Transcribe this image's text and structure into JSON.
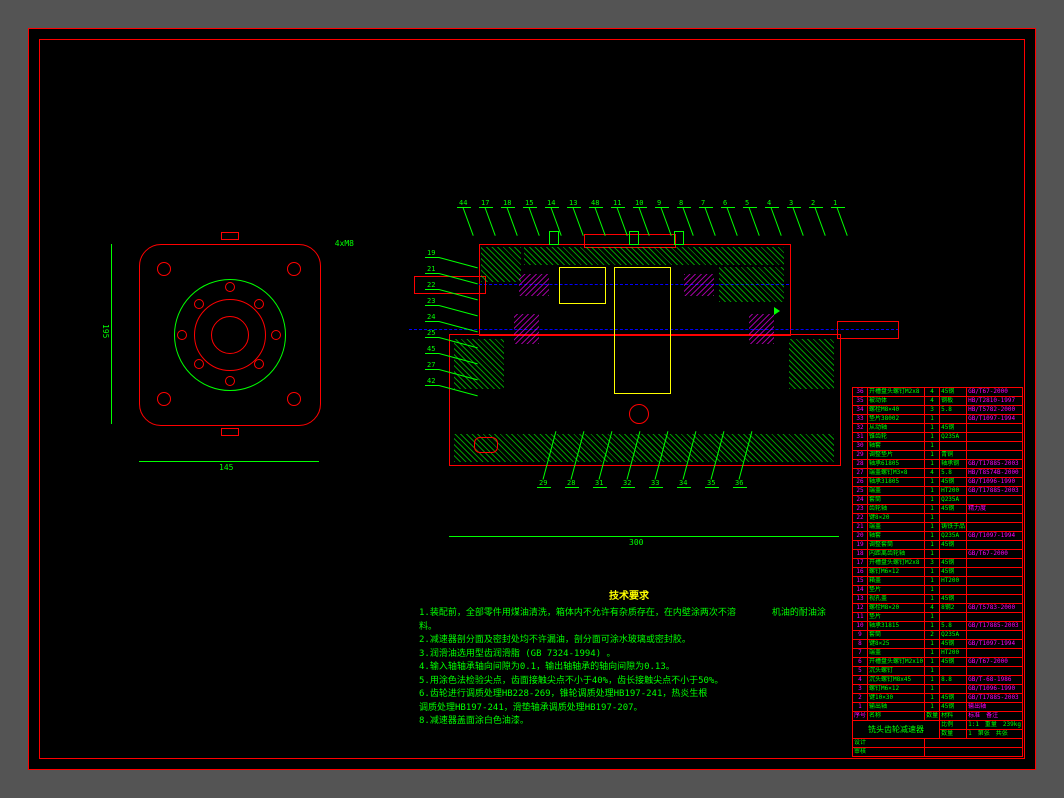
{
  "dimensions": {
    "flange_width": "145",
    "flange_height": "195",
    "section_length": "300",
    "hole_callout": "4xM8"
  },
  "tech_requirements": {
    "title": "技术要求",
    "items": [
      "1.装配前，全部零件用煤油清洗，箱体内不允许有杂质存在，在内壁涂两次不溶　　　　机油的耐油涂料。",
      "2.减速器剖分面及密封处均不许漏油，剖分面可涂水玻璃或密封胶。",
      "3.润滑油选用型齿润滑脂 (GB 7324-1994) 。",
      "4.输入轴轴承轴向间隙为0.1，输出轴轴承的轴向间隙为0.13。",
      "5.用涂色法检验尖点，齿面接触尖点不小于40%，齿长接触尖点不小于50%。",
      "6.齿轮进行调质处理HB228-269，锥轮调质处理HB197-241，热炎生根",
      "调质处理HB197-241，滑垫轴承调质处理HB197-207。",
      "8.减速器盖面涂白色油漆。"
    ]
  },
  "bom": [
    {
      "n": "36",
      "name": "开槽盘头螺钉M2x8",
      "q": "4",
      "mat": "45钢",
      "std": "GB/T67-2000"
    },
    {
      "n": "35",
      "name": "被动体",
      "q": "4",
      "mat": "钢板",
      "std": "HB/T2810-1997"
    },
    {
      "n": "34",
      "name": "螺栓M8×40",
      "q": "3",
      "mat": "5.8",
      "std": "HB/T5782-2000"
    },
    {
      "n": "33",
      "name": "垫片38002",
      "q": "1",
      "mat": "",
      "std": "GB/T1097-1994"
    },
    {
      "n": "32",
      "name": "从动轴",
      "q": "1",
      "mat": "45钢",
      "std": ""
    },
    {
      "n": "31",
      "name": "锥齿轮",
      "q": "1",
      "mat": "Q235A",
      "std": ""
    },
    {
      "n": "30",
      "name": "轴套",
      "q": "1",
      "mat": "",
      "std": ""
    },
    {
      "n": "29",
      "name": "调整垫片",
      "q": "1",
      "mat": "青铜",
      "std": ""
    },
    {
      "n": "28",
      "name": "轴承61805",
      "q": "1",
      "mat": "轴承钢",
      "std": "GB/T17885-2003"
    },
    {
      "n": "27",
      "name": "端盖螺钉M3×8",
      "q": "4",
      "mat": "5.8",
      "std": "HB/T8574B-2000"
    },
    {
      "n": "26",
      "name": "轴承31805",
      "q": "1",
      "mat": "45钢",
      "std": "GB/T1096-1990"
    },
    {
      "n": "25",
      "name": "端盖",
      "q": "1",
      "mat": "HT200",
      "std": "GB/T17885-2003"
    },
    {
      "n": "24",
      "name": "套筒",
      "q": "1",
      "mat": "Q235A",
      "std": ""
    },
    {
      "n": "23",
      "name": "齿轮轴",
      "q": "1",
      "mat": "45钢",
      "std": "精力度"
    },
    {
      "n": "22",
      "name": "键8×20",
      "q": "1",
      "mat": "",
      "std": ""
    },
    {
      "n": "21",
      "name": "端盖",
      "q": "1",
      "mat": "铸铁于品",
      "std": ""
    },
    {
      "n": "20",
      "name": "轴套",
      "q": "1",
      "mat": "Q235A",
      "std": "GB/T1097-1994"
    },
    {
      "n": "19",
      "name": "调整套筒",
      "q": "1",
      "mat": "45钢",
      "std": ""
    },
    {
      "n": "18",
      "name": "内距离齿轮轴",
      "q": "1",
      "mat": "",
      "std": "GB/T67-2000"
    },
    {
      "n": "17",
      "name": "开槽盘头螺钉M2x8",
      "q": "3",
      "mat": "45钢",
      "std": ""
    },
    {
      "n": "16",
      "name": "螺钉M6×12",
      "q": "1",
      "mat": "45钢",
      "std": ""
    },
    {
      "n": "15",
      "name": "箱盖",
      "q": "1",
      "mat": "HT200",
      "std": ""
    },
    {
      "n": "14",
      "name": "垫片",
      "q": "1",
      "mat": "",
      "std": ""
    },
    {
      "n": "13",
      "name": "视孔盖",
      "q": "1",
      "mat": "45钢",
      "std": ""
    },
    {
      "n": "12",
      "name": "螺栓M8×20",
      "q": "4",
      "mat": "8钢2",
      "std": "GB/T5783-2000"
    },
    {
      "n": "11",
      "name": "垫片",
      "q": "1",
      "mat": "",
      "std": ""
    },
    {
      "n": "10",
      "name": "轴承31815",
      "q": "1",
      "mat": "5.8",
      "std": "GB/T17885-2003"
    },
    {
      "n": "9",
      "name": "套筒",
      "q": "2",
      "mat": "Q235A",
      "std": ""
    },
    {
      "n": "8",
      "name": "键8×25",
      "q": "1",
      "mat": "45钢",
      "std": "GB/T1097-1994"
    },
    {
      "n": "7",
      "name": "端盖",
      "q": "1",
      "mat": "HT200",
      "std": ""
    },
    {
      "n": "6",
      "name": "开槽盘头螺钉M2x10",
      "q": "1",
      "mat": "45钢",
      "std": "GB/T67-2000"
    },
    {
      "n": "5",
      "name": "沉头螺钉",
      "q": "1",
      "mat": "",
      "std": ""
    },
    {
      "n": "4",
      "name": "沉头螺钉M8x45",
      "q": "1",
      "mat": "8.8",
      "std": "GB/T-68-1986"
    },
    {
      "n": "3",
      "name": "螺钉M6×12",
      "q": "1",
      "mat": "",
      "std": "GB/T1096-1990"
    },
    {
      "n": "2",
      "name": "键10×30",
      "q": "1",
      "mat": "45钢",
      "std": "GB/T17885-2003"
    },
    {
      "n": "1",
      "name": "输出轴",
      "q": "1",
      "mat": "45钢",
      "std": "输出轴"
    }
  ],
  "bom_header": {
    "n": "序号",
    "name": "名称",
    "q": "数量",
    "mat": "材料",
    "std": "标准",
    "note": "备注"
  },
  "title_block": {
    "name": "铣头齿轮减速器",
    "design": "设计",
    "check": "审核",
    "scale_label": "比例",
    "scale": "1:1",
    "qty_label": "数量",
    "qty": "1",
    "sheet": "第张",
    "total": "共张",
    "mass_label": "重量",
    "mass": "239kg"
  },
  "balloons_top": [
    "44",
    "17",
    "18",
    "15",
    "14",
    "13",
    "48",
    "11",
    "10",
    "9",
    "8",
    "7",
    "6",
    "5",
    "4",
    "3",
    "2",
    "1"
  ],
  "balloons_left": [
    "19",
    "21",
    "22",
    "23",
    "24",
    "25",
    "45",
    "27",
    "42"
  ],
  "balloons_bottom": [
    "29",
    "28",
    "31",
    "32",
    "33",
    "34",
    "35",
    "36"
  ]
}
